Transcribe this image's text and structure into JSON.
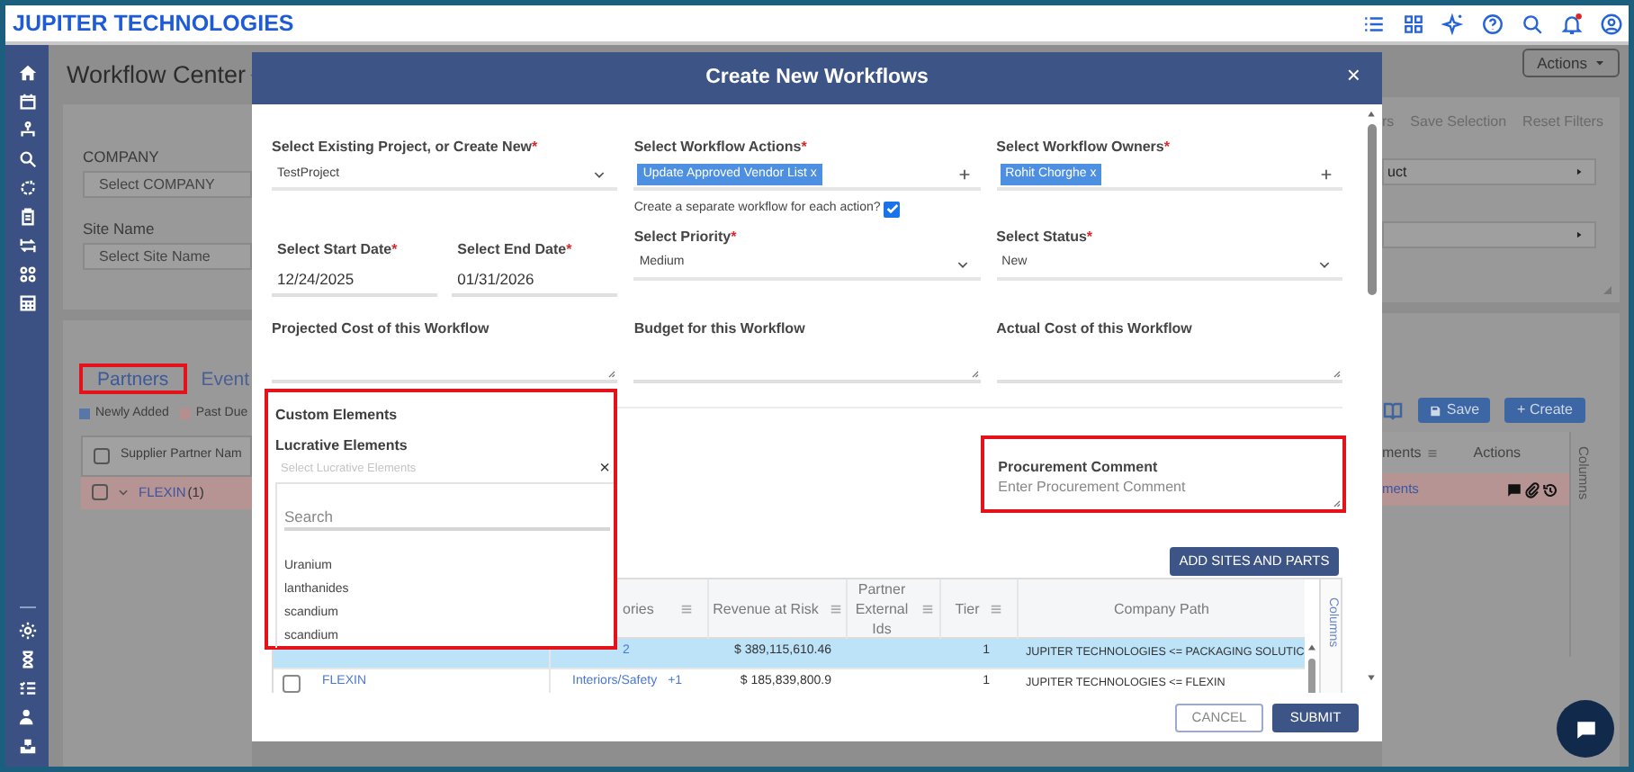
{
  "app_bar": {
    "logo": "JUPITER TECHNOLOGIES",
    "has_notification": true
  },
  "page": {
    "title": "Workflow Center",
    "actions_button": "Actions",
    "filters": [
      {
        "label": "COMPANY",
        "placeholder": "Select COMPANY"
      },
      {
        "label": "Site Name",
        "placeholder": "Select Site Name"
      }
    ],
    "filter_links": [
      "rs",
      "Save Selection",
      "Reset Filters"
    ],
    "right_filters": [
      {
        "value": "uct"
      }
    ],
    "tabs": [
      {
        "label": "Partners",
        "selected": true,
        "highlighted": true
      },
      {
        "label": "Event",
        "selected": false,
        "highlighted": false
      }
    ],
    "legend": [
      {
        "label": "Newly Added",
        "color": "#5876a6"
      },
      {
        "label": "Past Due",
        "color": "#b58f8f"
      }
    ],
    "toolbar": {
      "save": "Save",
      "create": "+ Create"
    },
    "table": {
      "all_checked": false,
      "columns": [
        "Supplier Partner Nam",
        "ments",
        "Actions"
      ],
      "side_panel": "Columns",
      "rows": [
        {
          "checked": false,
          "expanded": true,
          "name": "FLEXIN",
          "count": "(1)",
          "comments": "ments"
        }
      ]
    }
  },
  "modal": {
    "title": "Create New Workflows",
    "close": "×",
    "form_rows": [
      [
        {
          "kind": "select",
          "label": "Select Existing Project, or Create New",
          "mark": "*",
          "value": "TestProject"
        },
        {
          "kind": "chips",
          "label": "Select Workflow Actions",
          "mark": "*",
          "chips": [
            {
              "label": "Update Approved Vendor List",
              "remove": "x"
            }
          ],
          "option": {
            "label": "Create a separate workflow for each action?",
            "checked": true
          }
        },
        {
          "kind": "chips",
          "label": "Select Workflow Owners",
          "mark": "*",
          "chips": [
            {
              "label": "Rohit Chorghe",
              "remove": "x"
            }
          ]
        }
      ],
      [
        {
          "kind": "pair",
          "fields": [
            {
              "kind": "date",
              "label": "Select Start Date",
              "mark": "*",
              "value": "12/24/2025"
            },
            {
              "kind": "date",
              "label": "Select End Date",
              "mark": "*",
              "value": "01/31/2026"
            }
          ]
        },
        {
          "kind": "select",
          "label": "Select Priority",
          "mark": "*",
          "value": "Medium"
        },
        {
          "kind": "select",
          "label": "Select Status",
          "mark": "*",
          "value": "New"
        }
      ],
      [
        {
          "kind": "textarea",
          "label": "Projected Cost of this Workflow"
        },
        {
          "kind": "textarea",
          "label": "Budget for this Workflow"
        },
        {
          "kind": "textarea",
          "label": "Actual Cost of this Workflow"
        }
      ]
    ],
    "custom_elements": {
      "heading": "Custom Elements",
      "highlighted": true,
      "field": {
        "label": "Lucrative Elements",
        "placeholder": "Select Lucrative Elements",
        "clear": "×",
        "expanded": true
      },
      "search_placeholder": "Search",
      "options": [
        "Uranium",
        "lanthanides",
        "scandium",
        "scandium"
      ]
    },
    "procurement_comment": {
      "label": "Procurement Comment",
      "placeholder": "Enter Procurement Comment",
      "highlighted": true
    },
    "add_button": "ADD SITES AND PARTS",
    "sites_table": {
      "columns": [
        "ories",
        "Revenue at Risk",
        "Partner External Ids",
        "Tier",
        "Company Path"
      ],
      "side_panel": "Columns",
      "rows": [
        {
          "selected": true,
          "category": "2",
          "revenue": "$ 389,115,610.46",
          "tier": "1",
          "path": "JUPITER TECHNOLOGIES <= PACKAGING SOLUTIC"
        },
        {
          "selected": false,
          "checked": false,
          "name": "FLEXIN",
          "category": "Interiors/Safety",
          "category_more": "+1",
          "revenue": "$ 185,839,800.9",
          "tier": "1",
          "path": "JUPITER TECHNOLOGIES <= FLEXIN"
        }
      ]
    },
    "buttons": {
      "cancel": "CANCEL",
      "submit": "SUBMIT"
    }
  }
}
